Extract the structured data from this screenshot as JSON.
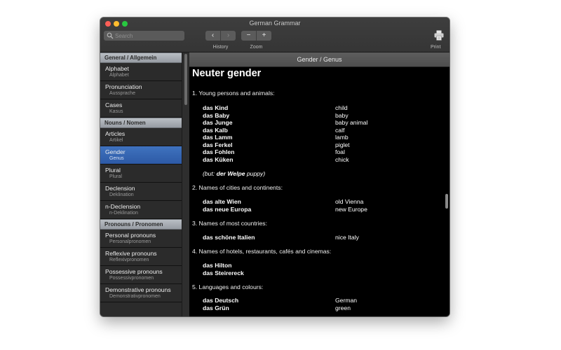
{
  "window": {
    "title": "German Grammar"
  },
  "toolbar": {
    "search_placeholder": "Search",
    "back_glyph": "‹",
    "forward_glyph": "›",
    "zoom_out_glyph": "−",
    "zoom_in_glyph": "+",
    "history_label": "History",
    "zoom_label": "Zoom",
    "print_label": "Print"
  },
  "colors": {
    "selection": "#2d5aa6",
    "header_gradient_top": "#b9bec4",
    "content_background": "#000000",
    "close": "#fe5f57",
    "minimize": "#febc2e",
    "maximize": "#28c840"
  },
  "sidebar": {
    "sections": [
      {
        "header": "General / Allgemein",
        "items": [
          {
            "title": "Alphabet",
            "subtitle": "Alphabet"
          },
          {
            "title": "Pronunciation",
            "subtitle": "Aussprache"
          },
          {
            "title": "Cases",
            "subtitle": "Kasus"
          }
        ]
      },
      {
        "header": "Nouns / Nomen",
        "items": [
          {
            "title": "Articles",
            "subtitle": "Artikel"
          },
          {
            "title": "Gender",
            "subtitle": "Genus",
            "selected": true
          },
          {
            "title": "Plural",
            "subtitle": "Plural"
          },
          {
            "title": "Declension",
            "subtitle": "Deklination"
          },
          {
            "title": "n-Declension",
            "subtitle": "n-Deklination"
          }
        ]
      },
      {
        "header": "Pronouns / Pronomen",
        "items": [
          {
            "title": "Personal pronouns",
            "subtitle": "Personalpronomen"
          },
          {
            "title": "Reflexive pronouns",
            "subtitle": "Reflexivpronomen"
          },
          {
            "title": "Possessive pronouns",
            "subtitle": "Possessivpronomen"
          },
          {
            "title": "Demonstrative pronouns",
            "subtitle": "Demonstrativpronomen"
          }
        ]
      }
    ]
  },
  "content": {
    "header": "Gender / Genus",
    "title": "Neuter gender",
    "sections": [
      {
        "heading": "1. Young persons and animals:",
        "rows": [
          {
            "de": "das Kind",
            "en": "child"
          },
          {
            "de": "das Baby",
            "en": "baby"
          },
          {
            "de": "das Junge",
            "en": "baby animal"
          },
          {
            "de": "das Kalb",
            "en": "calf"
          },
          {
            "de": "das Lamm",
            "en": "lamb"
          },
          {
            "de": "das Ferkel",
            "en": "piglet"
          },
          {
            "de": "das Fohlen",
            "en": "foal"
          },
          {
            "de": "das Küken",
            "en": "chick"
          }
        ],
        "note": {
          "prefix": "(but: ",
          "bold": "der Welpe",
          "suffix": " puppy)"
        }
      },
      {
        "heading": "2. Names of cities and continents:",
        "rows": [
          {
            "de": "das alte Wien",
            "en": "old Vienna"
          },
          {
            "de": "das neue Europa",
            "en": "new Europe"
          }
        ]
      },
      {
        "heading": "3. Names of most countries:",
        "rows": [
          {
            "de": "das schöne Italien",
            "en": "nice Italy"
          }
        ]
      },
      {
        "heading": "4. Names of hotels, restaurants, cafés and cinemas:",
        "rows": [
          {
            "de": "das Hilton",
            "en": ""
          },
          {
            "de": "das Steirereck",
            "en": ""
          }
        ]
      },
      {
        "heading": "5. Languages and colours:",
        "rows": [
          {
            "de": "das Deutsch",
            "en": "German"
          },
          {
            "de": "das Grün",
            "en": "green"
          }
        ]
      }
    ]
  }
}
